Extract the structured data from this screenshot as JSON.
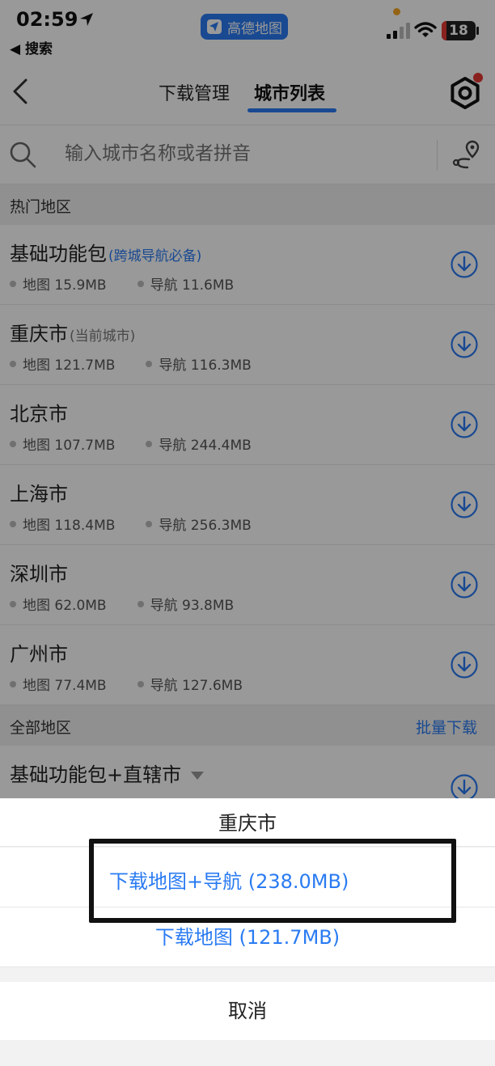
{
  "status": {
    "time": "02:59",
    "back_app": "◀ 搜索",
    "app_name": "高德地图",
    "battery": "18"
  },
  "nav": {
    "tabs": [
      {
        "label": "下载管理",
        "active": false
      },
      {
        "label": "城市列表",
        "active": true
      }
    ]
  },
  "search": {
    "placeholder": "输入城市名称或者拼音"
  },
  "hot": {
    "title": "热门地区",
    "items": [
      {
        "name": "基础功能包",
        "tag": "(跨城导航必备)",
        "map": "地图 15.9MB",
        "nav": "导航 11.6MB"
      },
      {
        "name": "重庆市",
        "tag": "(当前城市)",
        "map": "地图 121.7MB",
        "nav": "导航 116.3MB"
      },
      {
        "name": "北京市",
        "tag": "",
        "map": "地图 107.7MB",
        "nav": "导航 244.4MB"
      },
      {
        "name": "上海市",
        "tag": "",
        "map": "地图 118.4MB",
        "nav": "导航 256.3MB"
      },
      {
        "name": "深圳市",
        "tag": "",
        "map": "地图 62.0MB",
        "nav": "导航 93.8MB"
      },
      {
        "name": "广州市",
        "tag": "",
        "map": "地图 77.4MB",
        "nav": "导航 127.6MB"
      }
    ]
  },
  "all": {
    "title": "全部地区",
    "batch_label": "批量下载",
    "first_item": "基础功能包+直辖市"
  },
  "sheet": {
    "title": "重庆市",
    "option_map_nav": "下载地图+导航 (238.0MB)",
    "option_map": "下载地图 (121.7MB)",
    "cancel": "取消"
  },
  "colors": {
    "accent": "#2a7bf2",
    "badge_red": "#e53935"
  }
}
